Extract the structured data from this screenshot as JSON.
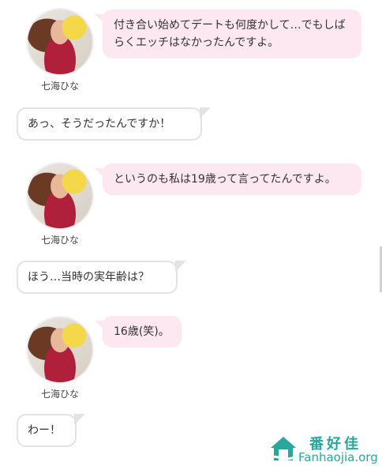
{
  "messages": [
    {
      "speaker": "七海ひな",
      "text": "付き合い始めてデートも何度かして…でもしばらくエッチはなかったんですよ。"
    },
    {
      "speaker": "interviewer",
      "text": "あっ、そうだったんですか！"
    },
    {
      "speaker": "七海ひな",
      "text": "というのも私は19歳って言ってたんですよ。"
    },
    {
      "speaker": "interviewer",
      "text": "ほう…当時の実年齢は？"
    },
    {
      "speaker": "七海ひな",
      "text": "16歳(笑)。"
    },
    {
      "speaker": "interviewer",
      "text": "わー！"
    }
  ],
  "watermark": {
    "cn": "番好佳",
    "en": "Fanhaojia.org"
  },
  "colors": {
    "pink_bubble": "#fde7f0",
    "white_bubble_border": "#e3e3e3",
    "watermark": "#2aa79b"
  }
}
